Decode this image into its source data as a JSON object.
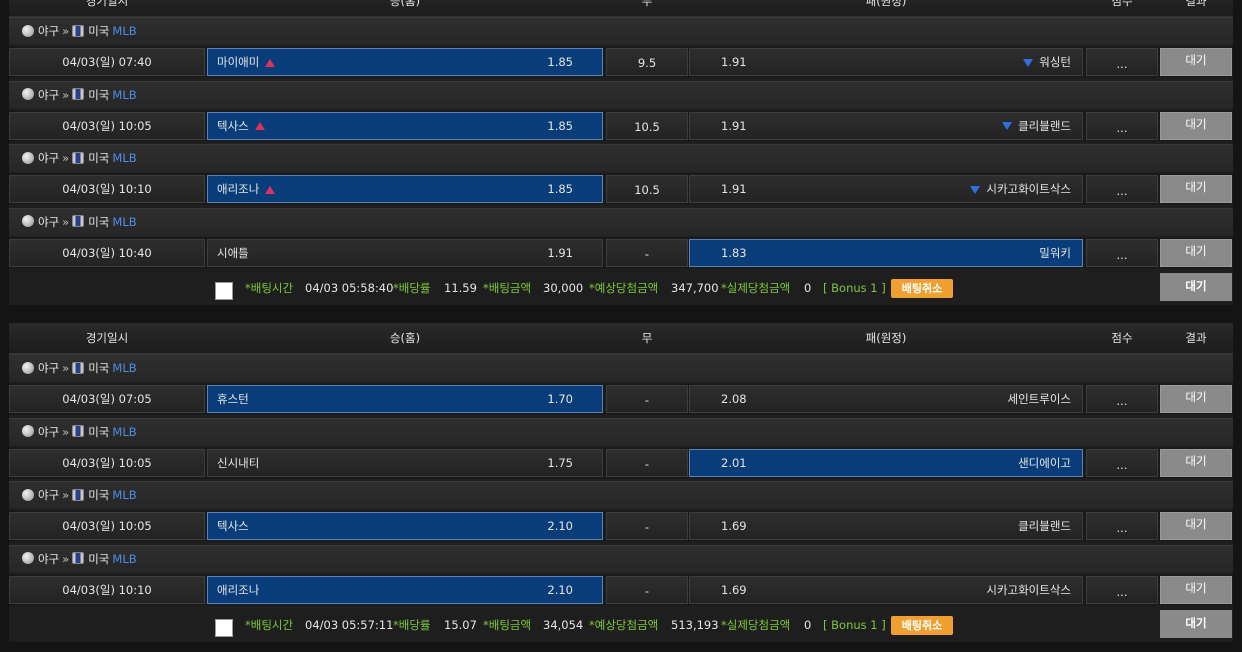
{
  "headers": {
    "date": "경기일시",
    "home": "승(홈)",
    "draw": "무",
    "away": "패(원정)",
    "score": "점수",
    "result": "결과"
  },
  "league": {
    "sport": "야구",
    "sep": "»",
    "country": "미국",
    "name": "MLB",
    "sport_icon": "baseball-icon",
    "flag_icon": "usa-flag-icon"
  },
  "slips": [
    {
      "games": [
        {
          "date": "04/03(일) 07:40",
          "home": "마이애미",
          "home_odds": "1.85",
          "draw": "9.5",
          "away_odds": "1.91",
          "away": "워싱턴",
          "score": "...",
          "result": "대기",
          "selected": "home",
          "home_trend": "up",
          "away_trend": "down"
        },
        {
          "date": "04/03(일) 10:05",
          "home": "텍사스",
          "home_odds": "1.85",
          "draw": "10.5",
          "away_odds": "1.91",
          "away": "클리블랜드",
          "score": "...",
          "result": "대기",
          "selected": "home",
          "home_trend": "up",
          "away_trend": "down"
        },
        {
          "date": "04/03(일) 10:10",
          "home": "애리조나",
          "home_odds": "1.85",
          "draw": "10.5",
          "away_odds": "1.91",
          "away": "시카고화이트삭스",
          "score": "...",
          "result": "대기",
          "selected": "home",
          "home_trend": "up",
          "away_trend": "down"
        },
        {
          "date": "04/03(일) 10:40",
          "home": "시애틀",
          "home_odds": "1.91",
          "draw": "-",
          "away_odds": "1.83",
          "away": "밀워키",
          "score": "...",
          "result": "대기",
          "selected": "away",
          "home_trend": "",
          "away_trend": ""
        }
      ],
      "footer": {
        "bet_time_label": "*배팅시간",
        "bet_time": "04/03 05:58:40",
        "odds_label": "*배당률",
        "odds": "11.59",
        "amount_label": "*배팅금액",
        "amount": "30,000",
        "expected_label": "*예상당첨금액",
        "expected": "347,700",
        "actual_label": "*실제당첨금액",
        "actual": "0",
        "bonus": "[ Bonus 1 ]",
        "cancel_label": "배팅취소",
        "result": "대기"
      }
    },
    {
      "games": [
        {
          "date": "04/03(일) 07:05",
          "home": "휴스턴",
          "home_odds": "1.70",
          "draw": "-",
          "away_odds": "2.08",
          "away": "세인트루이스",
          "score": "...",
          "result": "대기",
          "selected": "home",
          "home_trend": "",
          "away_trend": ""
        },
        {
          "date": "04/03(일) 10:05",
          "home": "신시내티",
          "home_odds": "1.75",
          "draw": "-",
          "away_odds": "2.01",
          "away": "샌디에이고",
          "score": "...",
          "result": "대기",
          "selected": "away",
          "home_trend": "",
          "away_trend": ""
        },
        {
          "date": "04/03(일) 10:05",
          "home": "텍사스",
          "home_odds": "2.10",
          "draw": "-",
          "away_odds": "1.69",
          "away": "클리블랜드",
          "score": "...",
          "result": "대기",
          "selected": "home",
          "home_trend": "",
          "away_trend": ""
        },
        {
          "date": "04/03(일) 10:10",
          "home": "애리조나",
          "home_odds": "2.10",
          "draw": "-",
          "away_odds": "1.69",
          "away": "시카고화이트삭스",
          "score": "...",
          "result": "대기",
          "selected": "home",
          "home_trend": "",
          "away_trend": ""
        }
      ],
      "footer": {
        "bet_time_label": "*배팅시간",
        "bet_time": "04/03 05:57:11",
        "odds_label": "*배당률",
        "odds": "15.07",
        "amount_label": "*배팅금액",
        "amount": "34,054",
        "expected_label": "*예상당첨금액",
        "expected": "513,193",
        "actual_label": "*실제당첨금액",
        "actual": "0",
        "bonus": "[ Bonus 1 ]",
        "cancel_label": "배팅취소",
        "result": "대기"
      }
    }
  ]
}
